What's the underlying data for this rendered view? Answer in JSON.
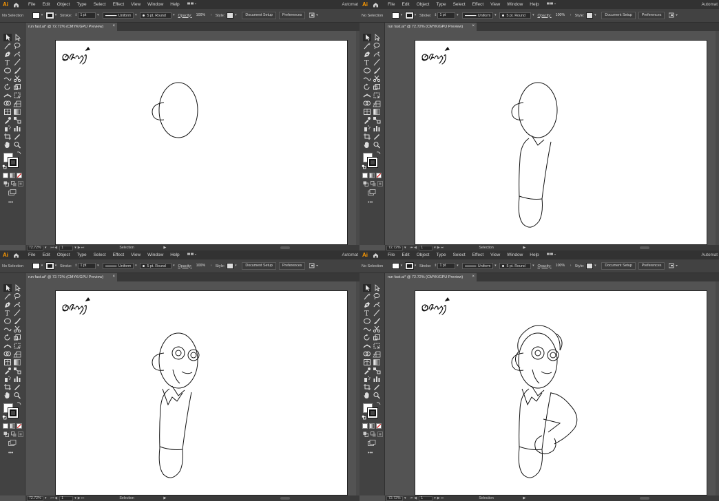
{
  "app": {
    "logo_text": "Ai",
    "menus": [
      "File",
      "Edit",
      "Object",
      "Type",
      "Select",
      "Effect",
      "View",
      "Window",
      "Help"
    ],
    "workspace": "Automat"
  },
  "control_bar": {
    "selection_state": "No Selection",
    "stroke_label": "Stroke:",
    "stroke_weight": "1 pt",
    "profile": "Uniform",
    "brush": "5 pt. Round",
    "opacity_label": "Opacity:",
    "opacity_value": "100%",
    "style_label": "Style:",
    "document_setup": "Document Setup",
    "preferences": "Preferences"
  },
  "document": {
    "tab_title": "run fast.ai* @ 72.72% (CMYK/GPU Preview)",
    "signature_text": "@shazi"
  },
  "status_bar": {
    "zoom": "72.72%",
    "artboard_number": "1",
    "current_tool": "Selection"
  },
  "panels": [
    {
      "stage": "head outline"
    },
    {
      "stage": "head and body outline"
    },
    {
      "stage": "face features added"
    },
    {
      "stage": "hair and arm added"
    }
  ],
  "icons": [
    "home-icon",
    "workspace-switcher-icon",
    "selection-tool-icon",
    "direct-selection-tool-icon",
    "pen-tool-icon",
    "type-tool-icon",
    "ellipse-tool-icon",
    "hand-tool-icon",
    "zoom-tool-icon",
    "close-icon"
  ]
}
